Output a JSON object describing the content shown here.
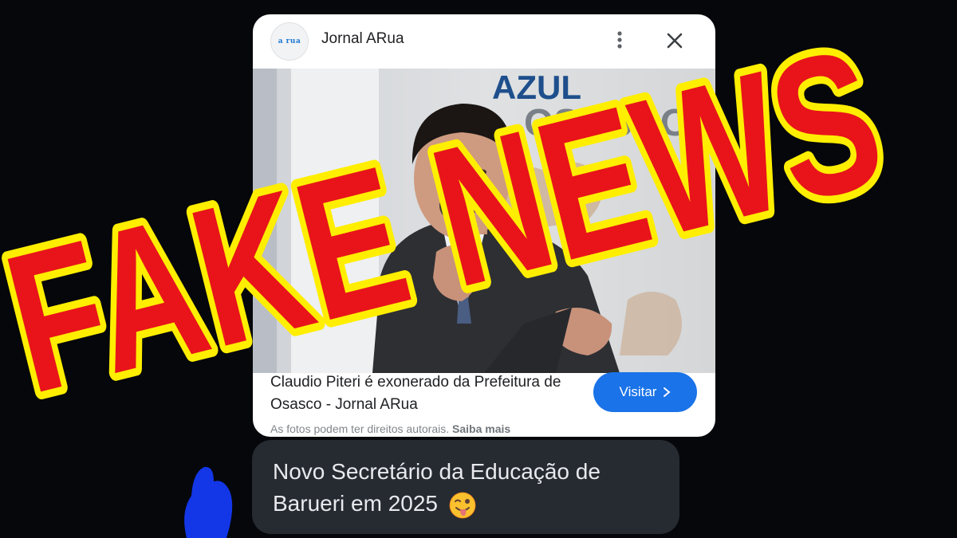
{
  "card": {
    "source_logo_text": "a rua",
    "source_name": "Jornal ARua",
    "photo_sign_line1": "AZUL",
    "photo_sign_line2": "OSASCO",
    "title": "Claudio Piteri é exonerado da Prefeitura de Osasco - Jornal ARua",
    "visit_label": "Visitar",
    "rights_text": "As fotos podem ter direitos autorais.",
    "rights_link": "Saiba mais"
  },
  "message": {
    "text": "Novo Secretário da Educação de Barueri em 2025",
    "emoji": "winking-face-with-tongue"
  },
  "overlay": {
    "stamp_text": "FAKE NEWS",
    "fill_color": "#e8141a",
    "outline_color": "#ffee00"
  },
  "colors": {
    "background": "#05070b",
    "accent": "#1a73e8",
    "bubble": "#262a31"
  }
}
